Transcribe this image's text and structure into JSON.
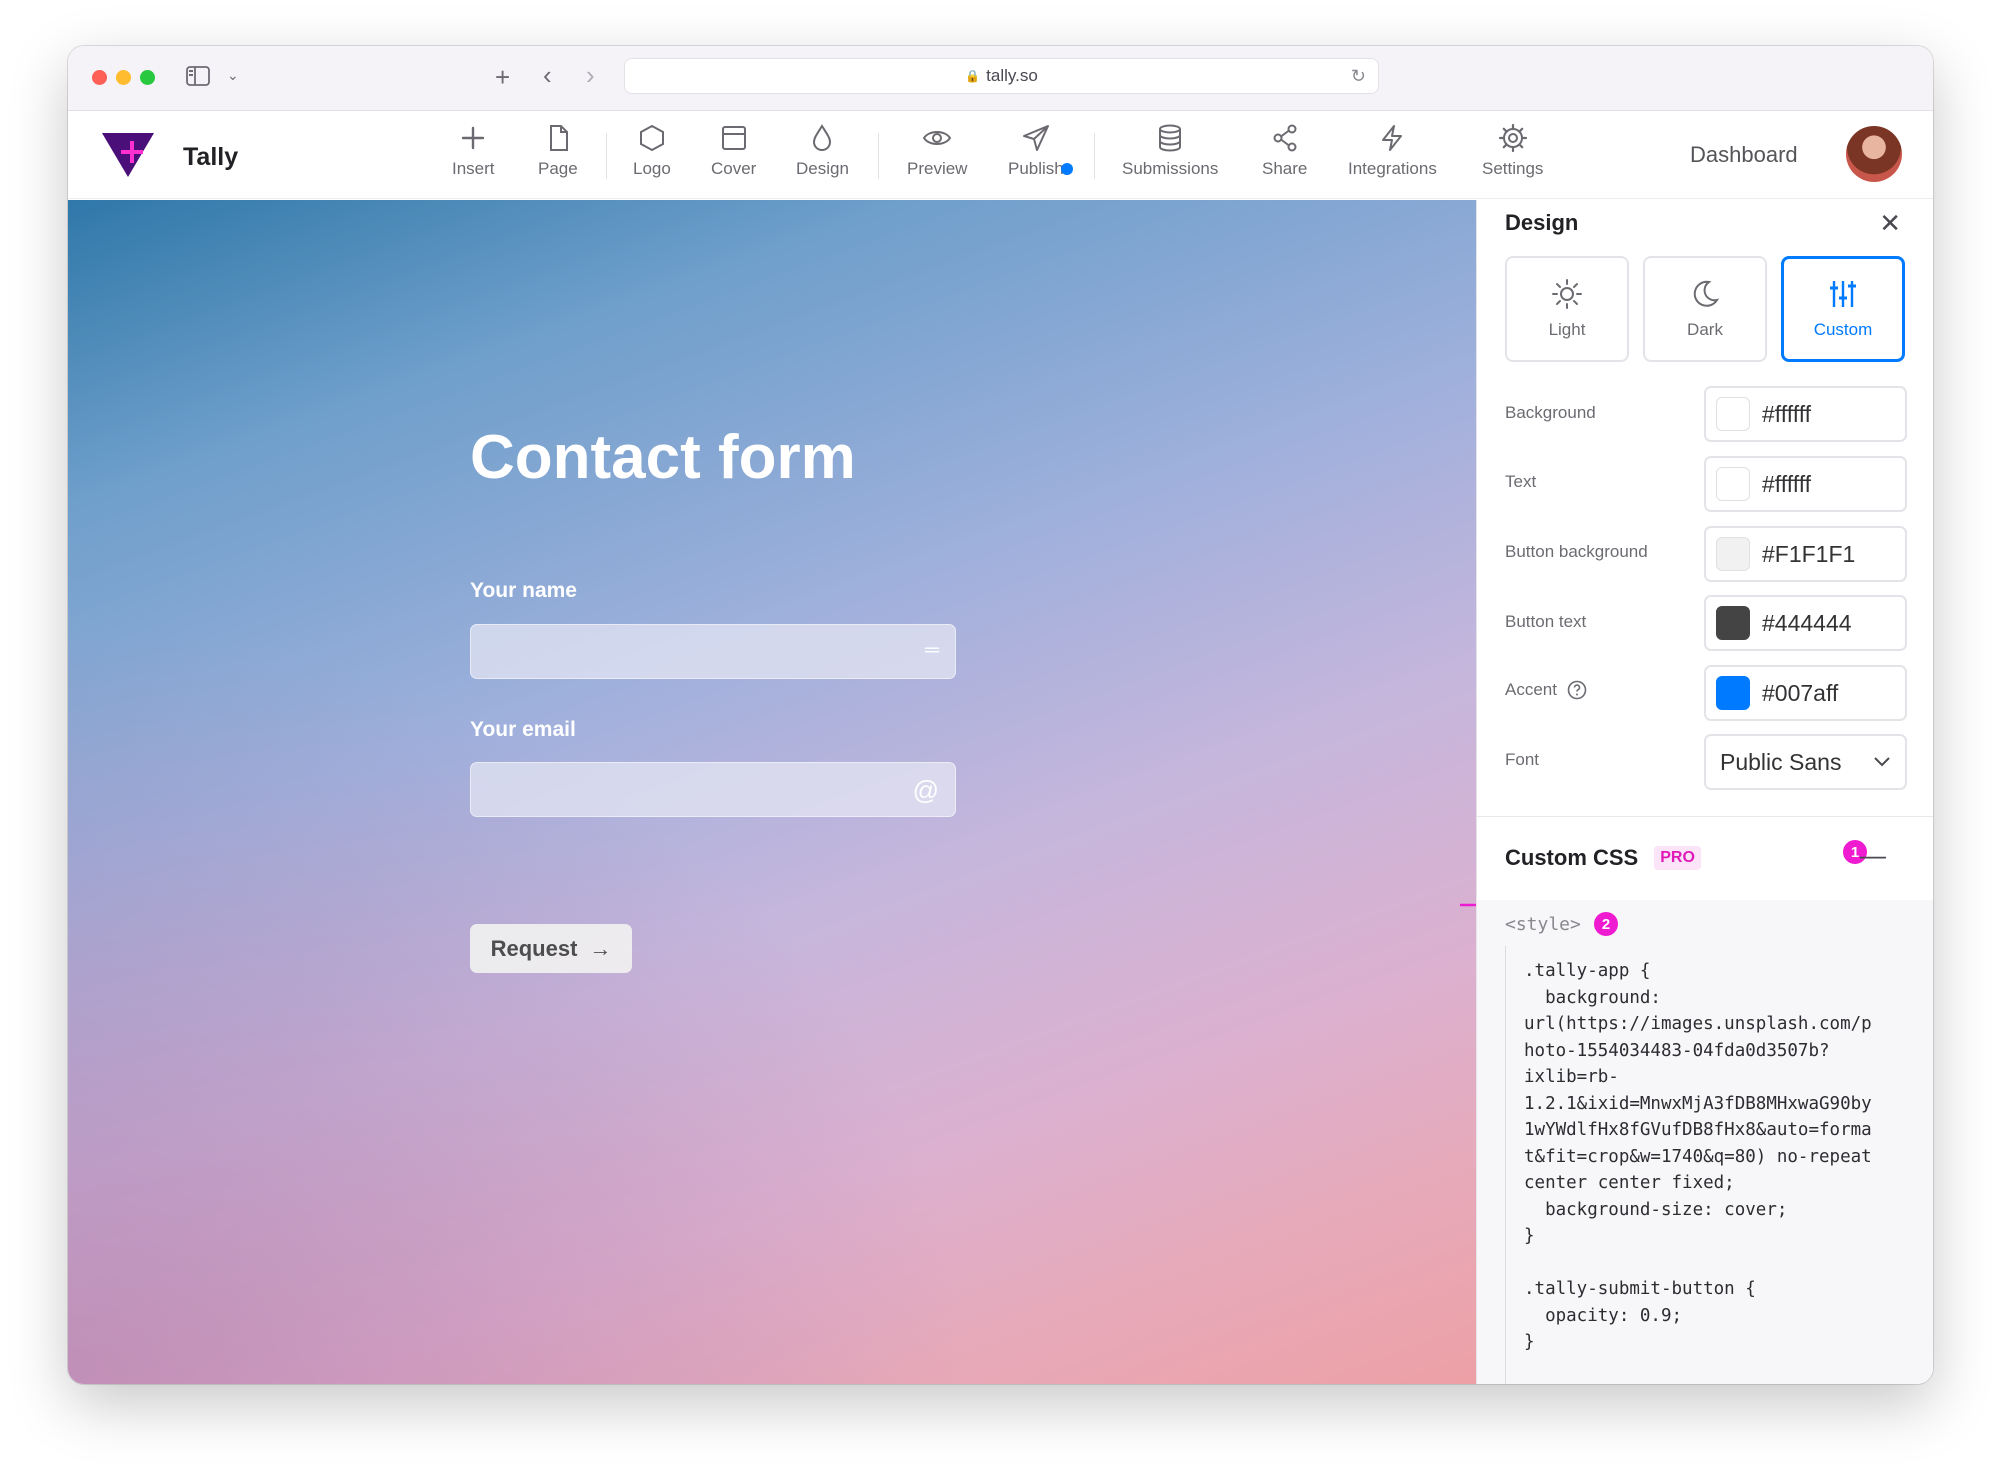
{
  "browser": {
    "url": "tally.so"
  },
  "app": {
    "brand": "Tally",
    "toolbar": [
      {
        "label": "Insert",
        "icon": "plus-icon"
      },
      {
        "label": "Page",
        "icon": "page-icon"
      },
      {
        "label": "Logo",
        "icon": "hexagon-icon"
      },
      {
        "label": "Cover",
        "icon": "cover-icon"
      },
      {
        "label": "Design",
        "icon": "drop-icon"
      },
      {
        "label": "Preview",
        "icon": "eye-icon"
      },
      {
        "label": "Publish",
        "icon": "send-icon"
      },
      {
        "label": "Submissions",
        "icon": "database-icon"
      },
      {
        "label": "Share",
        "icon": "share-icon"
      },
      {
        "label": "Integrations",
        "icon": "bolt-icon"
      },
      {
        "label": "Settings",
        "icon": "gear-icon"
      }
    ],
    "dashboard_label": "Dashboard"
  },
  "form": {
    "title": "Contact form",
    "fields": [
      {
        "label": "Your name",
        "value": "",
        "icon": "short-text-icon",
        "icon_glyph": "═"
      },
      {
        "label": "Your email",
        "value": "",
        "icon": "at-icon",
        "icon_glyph": "@"
      }
    ],
    "submit_label": "Request",
    "submit_icon": "arrow-right-icon"
  },
  "design_panel": {
    "title": "Design",
    "themes": [
      {
        "label": "Light",
        "icon": "sun-icon",
        "active": false
      },
      {
        "label": "Dark",
        "icon": "moon-icon",
        "active": false
      },
      {
        "label": "Custom",
        "icon": "sliders-icon",
        "active": true
      }
    ],
    "colors": [
      {
        "label": "Background",
        "value": "#ffffff",
        "swatch": "#ffffff"
      },
      {
        "label": "Text",
        "value": "#ffffff",
        "swatch": "#ffffff"
      },
      {
        "label": "Button background",
        "value": "#F1F1F1",
        "swatch": "#F1F1F1"
      },
      {
        "label": "Button text",
        "value": "#444444",
        "swatch": "#444444"
      },
      {
        "label": "Accent",
        "value": "#007aff",
        "swatch": "#007aff",
        "help_icon": "help-circle-icon"
      }
    ],
    "font": {
      "label": "Font",
      "value": "Public Sans"
    },
    "custom_css": {
      "title": "Custom CSS",
      "badge": "PRO",
      "step_badge_1": "1",
      "step_badge_2": "2",
      "style_tag": "<style>",
      "code": ".tally-app {\n  background:\nurl(https://images.unsplash.com/p\nhoto-1554034483-04fda0d3507b?\nixlib=rb-\n1.2.1&ixid=MnwxMjA3fDB8MHxwaG90by\n1wYWdlfHx8fGVufDB8fHx8&auto=forma\nt&fit=crop&w=1740&q=80) no-repeat\ncenter center fixed;\n  background-size: cover;\n}\n\n.tally-submit-button {\n  opacity: 0.9;\n}"
    }
  },
  "colors": {
    "accent": "#007aff",
    "pink": "#ee1bd0",
    "brand_purple": "#4b0f7a"
  }
}
